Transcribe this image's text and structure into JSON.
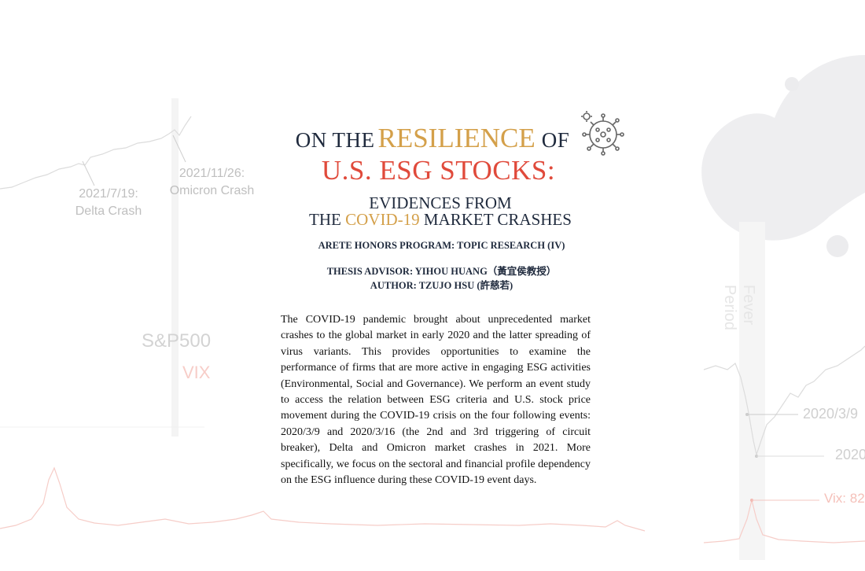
{
  "title": {
    "on_the": "ON THE",
    "resilience": "RESILIENCE",
    "of": "OF",
    "line2": "U.S. ESG STOCKS:"
  },
  "subtitle": {
    "line1": "EVIDENCES FROM",
    "line2_prefix": "THE ",
    "line2_highlight": "COVID-19",
    "line2_suffix": " MARKET CRASHES"
  },
  "program": "ARETE HONORS PROGRAM: TOPIC RESEARCH (IV)",
  "advisor": "THESIS ADVISOR: YIHOU HUANG（黃宜侯教授）",
  "author": "AUTHOR: TZUJO HSU (許慈若)",
  "abstract": "The COVID-19 pandemic brought about unprecedented market crashes to the global market in early 2020 and the latter spreading of virus variants. This provides opportunities to examine the performance of firms that are more active in engaging ESG activities (Environmental, Social and Governance). We perform an event study to access the relation between ESG criteria and U.S. stock price movement during the COVID-19 crisis on the four following events: 2020/3/9 and 2020/3/16 (the 2nd and 3rd triggering of circuit breaker), Delta and Omicron market crashes in 2021. More specifically, we focus on the sectoral and financial profile dependency on the ESG influence during these COVID-19 event days.",
  "background": {
    "delta_annotation": "2021/7/19:\nDelta Crash",
    "omicron_annotation": "2021/11/26:\nOmicron Crash",
    "sp500_label": "S&P500",
    "vix_label": "VIX",
    "fever_period": "Fever\nPeriod",
    "event_1": "2020/3/9",
    "event_2": "2020",
    "vix_peak": "Vix: 82"
  },
  "colors": {
    "navy": "#1f2a3d",
    "gold": "#d4a04a",
    "red": "#e04a3b",
    "faint_gray": "#bfbfbf",
    "faint_pink": "#f4c2bd"
  },
  "icons": [
    "virus-icon"
  ]
}
